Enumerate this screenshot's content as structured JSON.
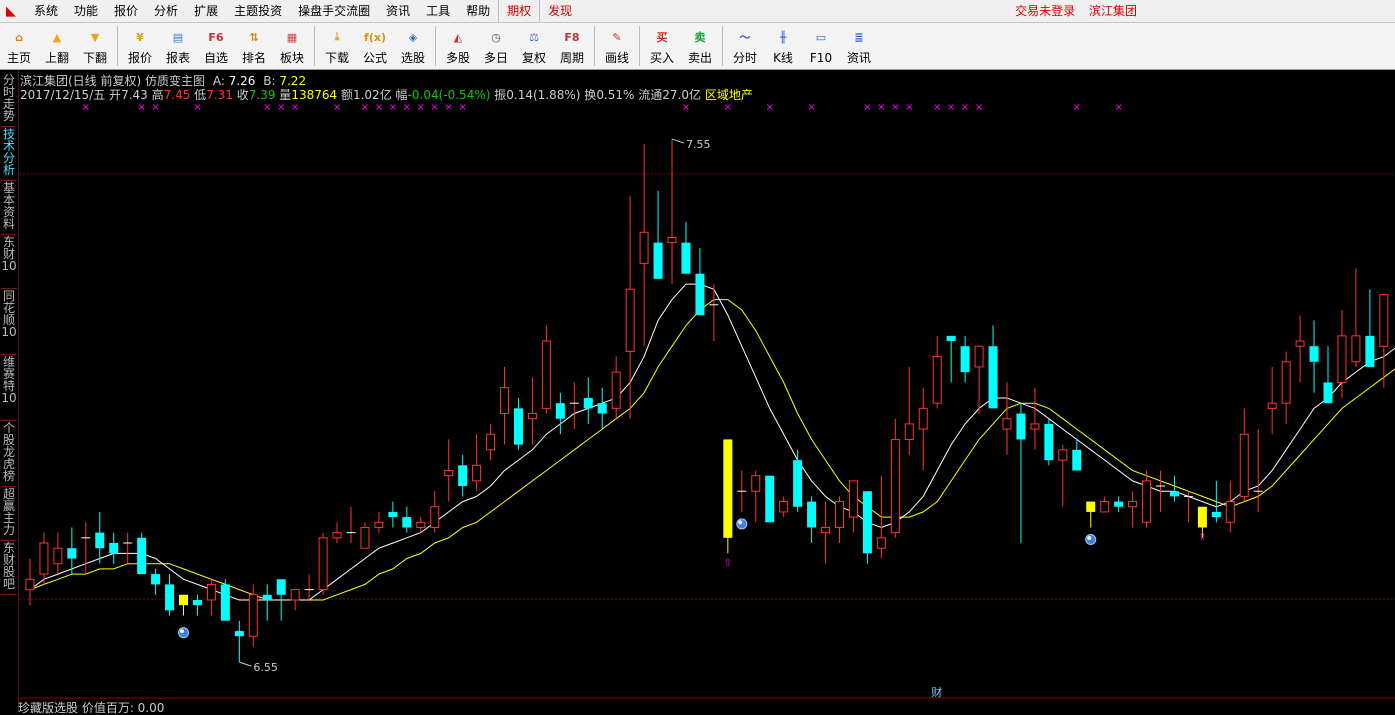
{
  "menubar": {
    "items": [
      "系统",
      "功能",
      "报价",
      "分析",
      "扩展",
      "主题投资",
      "操盘手交流圈",
      "资讯",
      "工具",
      "帮助"
    ],
    "red_items": [
      "期权",
      "发现"
    ],
    "status": "交易未登录",
    "stock": "滨江集团"
  },
  "toolbar": {
    "groups": [
      [
        {
          "label": "主页",
          "icon": "home-icon",
          "glyph": "⌂",
          "color": "#e57a1c"
        },
        {
          "label": "上翻",
          "icon": "arrow-up-icon",
          "glyph": "▲",
          "color": "#f0a020"
        },
        {
          "label": "下翻",
          "icon": "arrow-down-icon",
          "glyph": "▼",
          "color": "#f0a020"
        }
      ],
      [
        {
          "label": "报价",
          "icon": "yen-icon",
          "glyph": "¥",
          "color": "#e0a010"
        },
        {
          "label": "报表",
          "icon": "report-icon",
          "glyph": "▤",
          "color": "#3a7bd5"
        },
        {
          "label": "自选",
          "icon": "f6-icon",
          "glyph": "F6",
          "color": "#c03030"
        },
        {
          "label": "排名",
          "icon": "ranking-icon",
          "glyph": "⇅",
          "color": "#e08010"
        },
        {
          "label": "板块",
          "icon": "sector-icon",
          "glyph": "▦",
          "color": "#d04040"
        }
      ],
      [
        {
          "label": "下载",
          "icon": "download-icon",
          "glyph": "⤓",
          "color": "#e0a020"
        },
        {
          "label": "公式",
          "icon": "formula-icon",
          "glyph": "f(x)",
          "color": "#e09010"
        },
        {
          "label": "选股",
          "icon": "stock-pick-icon",
          "glyph": "◈",
          "color": "#3070c0"
        }
      ],
      [
        {
          "label": "多股",
          "icon": "multi-stock-icon",
          "glyph": "◭",
          "color": "#c03030"
        },
        {
          "label": "多日",
          "icon": "clock-icon",
          "glyph": "◷",
          "color": "#555555"
        },
        {
          "label": "复权",
          "icon": "restore-rights-icon",
          "glyph": "⚖",
          "color": "#3a6fd0"
        },
        {
          "label": "周期",
          "icon": "f8-icon",
          "glyph": "F8",
          "color": "#c03030"
        }
      ],
      [
        {
          "label": "画线",
          "icon": "draw-line-icon",
          "glyph": "✎",
          "color": "#c03030"
        }
      ],
      [
        {
          "label": "买入",
          "icon": "buy-icon",
          "glyph": "买",
          "color": "#d03020"
        },
        {
          "label": "卖出",
          "icon": "sell-icon",
          "glyph": "卖",
          "color": "#20a040"
        }
      ],
      [
        {
          "label": "分时",
          "icon": "intraday-icon",
          "glyph": "〜",
          "color": "#3060d0"
        },
        {
          "label": "K线",
          "icon": "kline-icon",
          "glyph": "╫",
          "color": "#3060d0"
        },
        {
          "label": "F10",
          "icon": "f10-icon",
          "glyph": "▭",
          "color": "#3060d0"
        },
        {
          "label": "资讯",
          "icon": "news-icon",
          "glyph": "≣",
          "color": "#3060d0"
        }
      ]
    ]
  },
  "side_tabs": [
    {
      "label": "分时走势",
      "active": false
    },
    {
      "label": "技术分析",
      "active": true
    },
    {
      "label": "基本资料",
      "active": false
    },
    {
      "label": "东财10",
      "active": false
    },
    {
      "label": "同花顺10",
      "active": false
    },
    {
      "label": "维赛特10",
      "active": false
    },
    {
      "label": "个股龙虎榜",
      "active": false
    },
    {
      "label": "超赢主力",
      "active": false
    },
    {
      "label": "东财股吧",
      "active": false
    }
  ],
  "chart_header": {
    "title": "滨江集团(日线 前复权) 仿质变主图",
    "a_label": "A:",
    "a_value": "7.26",
    "b_label": "B:",
    "b_value": "7.22"
  },
  "quote": {
    "date": "2017/12/15/五",
    "open_label": "开",
    "open": "7.43",
    "high_label": "高",
    "high": "7.45",
    "low_label": "低",
    "low": "7.31",
    "close_label": "收",
    "close": "7.39",
    "volume_label": "量",
    "volume": "138764",
    "amount_label": "额",
    "amount": "1.02亿",
    "change_label": "幅",
    "change": "-0.04(-0.54%)",
    "amplitude_label": "振",
    "amplitude": "0.14(1.88%)",
    "turnover_label": "换",
    "turnover": "0.51%",
    "float_label": "流通",
    "float": "27.0亿",
    "sector": "区域地产"
  },
  "annotations": {
    "high_mark": "7.55",
    "low_mark": "6.55",
    "finance_marker": "财"
  },
  "bottom_status": "珍藏版选股  价值百万: 0.00",
  "colors": {
    "up": "#ff3232",
    "down": "#00ffff",
    "special": "#ffff00",
    "ma_fast": "#ffffff",
    "ma_slow": "#ffff00",
    "marker": "#ff00ff",
    "grid": "#8b0000"
  },
  "chart_data": {
    "type": "candlestick",
    "y_range": [
      6.5,
      7.62
    ],
    "candles": [
      {
        "o": 6.69,
        "h": 6.75,
        "l": 6.66,
        "c": 6.71
      },
      {
        "o": 6.72,
        "h": 6.8,
        "l": 6.7,
        "c": 6.78
      },
      {
        "o": 6.74,
        "h": 6.8,
        "l": 6.72,
        "c": 6.77
      },
      {
        "o": 6.77,
        "h": 6.81,
        "l": 6.72,
        "c": 6.75
      },
      {
        "o": 6.79,
        "h": 6.82,
        "l": 6.72,
        "c": 6.79
      },
      {
        "o": 6.8,
        "h": 6.84,
        "l": 6.74,
        "c": 6.77
      },
      {
        "o": 6.78,
        "h": 6.8,
        "l": 6.74,
        "c": 6.76
      },
      {
        "o": 6.78,
        "h": 6.8,
        "l": 6.74,
        "c": 6.78
      },
      {
        "o": 6.79,
        "h": 6.8,
        "l": 6.72,
        "c": 6.72
      },
      {
        "o": 6.72,
        "h": 6.73,
        "l": 6.68,
        "c": 6.7
      },
      {
        "o": 6.7,
        "h": 6.72,
        "l": 6.64,
        "c": 6.65
      },
      {
        "o": 6.65,
        "h": 6.68,
        "l": 6.63,
        "c": 6.67
      },
      {
        "o": 6.67,
        "h": 6.68,
        "l": 6.64,
        "c": 6.66
      },
      {
        "o": 6.67,
        "h": 6.71,
        "l": 6.64,
        "c": 6.7
      },
      {
        "o": 6.7,
        "h": 6.71,
        "l": 6.63,
        "c": 6.63
      },
      {
        "o": 6.61,
        "h": 6.63,
        "l": 6.55,
        "c": 6.6
      },
      {
        "o": 6.6,
        "h": 6.7,
        "l": 6.58,
        "c": 6.68
      },
      {
        "o": 6.68,
        "h": 6.7,
        "l": 6.63,
        "c": 6.67
      },
      {
        "o": 6.71,
        "h": 6.71,
        "l": 6.63,
        "c": 6.68
      },
      {
        "o": 6.67,
        "h": 6.69,
        "l": 6.65,
        "c": 6.69
      },
      {
        "o": 6.69,
        "h": 6.72,
        "l": 6.67,
        "c": 6.69
      },
      {
        "o": 6.69,
        "h": 6.8,
        "l": 6.68,
        "c": 6.79
      },
      {
        "o": 6.79,
        "h": 6.82,
        "l": 6.78,
        "c": 6.8
      },
      {
        "o": 6.8,
        "h": 6.85,
        "l": 6.78,
        "c": 6.8
      },
      {
        "o": 6.77,
        "h": 6.82,
        "l": 6.77,
        "c": 6.81
      },
      {
        "o": 6.81,
        "h": 6.84,
        "l": 6.8,
        "c": 6.82
      },
      {
        "o": 6.84,
        "h": 6.86,
        "l": 6.81,
        "c": 6.83
      },
      {
        "o": 6.83,
        "h": 6.85,
        "l": 6.8,
        "c": 6.81
      },
      {
        "o": 6.81,
        "h": 6.83,
        "l": 6.8,
        "c": 6.82
      },
      {
        "o": 6.81,
        "h": 6.88,
        "l": 6.8,
        "c": 6.85
      },
      {
        "o": 6.91,
        "h": 6.98,
        "l": 6.86,
        "c": 6.92
      },
      {
        "o": 6.93,
        "h": 6.95,
        "l": 6.87,
        "c": 6.89
      },
      {
        "o": 6.9,
        "h": 6.99,
        "l": 6.88,
        "c": 6.93
      },
      {
        "o": 6.96,
        "h": 7.01,
        "l": 6.94,
        "c": 6.99
      },
      {
        "o": 7.03,
        "h": 7.12,
        "l": 6.97,
        "c": 7.08
      },
      {
        "o": 7.04,
        "h": 7.06,
        "l": 6.96,
        "c": 6.97
      },
      {
        "o": 7.02,
        "h": 7.1,
        "l": 6.97,
        "c": 7.03
      },
      {
        "o": 7.04,
        "h": 7.2,
        "l": 7.03,
        "c": 7.17
      },
      {
        "o": 7.05,
        "h": 7.07,
        "l": 6.99,
        "c": 7.02
      },
      {
        "o": 7.05,
        "h": 7.09,
        "l": 7.0,
        "c": 7.05
      },
      {
        "o": 7.06,
        "h": 7.1,
        "l": 7.01,
        "c": 7.04
      },
      {
        "o": 7.05,
        "h": 7.08,
        "l": 7.0,
        "c": 7.03
      },
      {
        "o": 7.04,
        "h": 7.14,
        "l": 7.02,
        "c": 7.11
      },
      {
        "o": 7.15,
        "h": 7.45,
        "l": 7.02,
        "c": 7.27
      },
      {
        "o": 7.32,
        "h": 7.55,
        "l": 7.16,
        "c": 7.38
      },
      {
        "o": 7.36,
        "h": 7.46,
        "l": 7.29,
        "c": 7.29
      },
      {
        "o": 7.36,
        "h": 7.56,
        "l": 7.28,
        "c": 7.37
      },
      {
        "o": 7.36,
        "h": 7.4,
        "l": 7.3,
        "c": 7.3
      },
      {
        "o": 7.3,
        "h": 7.35,
        "l": 7.22,
        "c": 7.22
      },
      {
        "o": 7.24,
        "h": 7.28,
        "l": 7.17,
        "c": 7.24
      },
      {
        "o": 6.98,
        "h": 6.98,
        "l": 6.76,
        "c": 6.88
      },
      {
        "o": 6.88,
        "h": 6.92,
        "l": 6.84,
        "c": 6.88
      },
      {
        "o": 6.88,
        "h": 6.92,
        "l": 6.82,
        "c": 6.91
      },
      {
        "o": 6.91,
        "h": 6.91,
        "l": 6.82,
        "c": 6.82
      },
      {
        "o": 6.84,
        "h": 6.87,
        "l": 6.83,
        "c": 6.86
      },
      {
        "o": 6.94,
        "h": 6.96,
        "l": 6.84,
        "c": 6.85
      },
      {
        "o": 6.86,
        "h": 6.87,
        "l": 6.78,
        "c": 6.81
      },
      {
        "o": 6.8,
        "h": 6.86,
        "l": 6.74,
        "c": 6.81
      },
      {
        "o": 6.81,
        "h": 6.87,
        "l": 6.78,
        "c": 6.86
      },
      {
        "o": 6.83,
        "h": 6.9,
        "l": 6.8,
        "c": 6.9
      },
      {
        "o": 6.88,
        "h": 6.88,
        "l": 6.74,
        "c": 6.76
      },
      {
        "o": 6.77,
        "h": 6.91,
        "l": 6.75,
        "c": 6.79
      },
      {
        "o": 6.8,
        "h": 7.02,
        "l": 6.79,
        "c": 6.98
      },
      {
        "o": 6.98,
        "h": 7.12,
        "l": 6.95,
        "c": 7.01
      },
      {
        "o": 7.0,
        "h": 7.08,
        "l": 6.92,
        "c": 7.04
      },
      {
        "o": 7.05,
        "h": 7.18,
        "l": 7.04,
        "c": 7.14
      },
      {
        "o": 7.18,
        "h": 7.17,
        "l": 7.09,
        "c": 7.17
      },
      {
        "o": 7.16,
        "h": 7.18,
        "l": 7.09,
        "c": 7.11
      },
      {
        "o": 7.12,
        "h": 7.16,
        "l": 7.03,
        "c": 7.16
      },
      {
        "o": 7.16,
        "h": 7.2,
        "l": 7.04,
        "c": 7.04
      },
      {
        "o": 7.0,
        "h": 7.09,
        "l": 6.95,
        "c": 7.02
      },
      {
        "o": 7.03,
        "h": 7.05,
        "l": 6.78,
        "c": 6.98
      },
      {
        "o": 7.0,
        "h": 7.08,
        "l": 6.96,
        "c": 7.01
      },
      {
        "o": 7.01,
        "h": 7.02,
        "l": 6.93,
        "c": 6.94
      },
      {
        "o": 6.94,
        "h": 6.97,
        "l": 6.85,
        "c": 6.96
      },
      {
        "o": 6.96,
        "h": 6.98,
        "l": 6.92,
        "c": 6.92
      },
      {
        "o": 6.86,
        "h": 6.9,
        "l": 6.81,
        "c": 6.84
      },
      {
        "o": 6.84,
        "h": 6.87,
        "l": 6.84,
        "c": 6.86
      },
      {
        "o": 6.86,
        "h": 6.87,
        "l": 6.84,
        "c": 6.85
      },
      {
        "o": 6.85,
        "h": 6.88,
        "l": 6.81,
        "c": 6.86
      },
      {
        "o": 6.82,
        "h": 6.92,
        "l": 6.81,
        "c": 6.9
      },
      {
        "o": 6.89,
        "h": 6.92,
        "l": 6.84,
        "c": 6.89
      },
      {
        "o": 6.88,
        "h": 6.91,
        "l": 6.86,
        "c": 6.87
      },
      {
        "o": 6.87,
        "h": 6.88,
        "l": 6.82,
        "c": 6.87
      },
      {
        "o": 6.86,
        "h": 6.86,
        "l": 6.81,
        "c": 6.84
      },
      {
        "o": 6.84,
        "h": 6.9,
        "l": 6.82,
        "c": 6.83
      },
      {
        "o": 6.82,
        "h": 6.9,
        "l": 6.8,
        "c": 6.86
      },
      {
        "o": 6.87,
        "h": 7.04,
        "l": 6.86,
        "c": 6.99
      },
      {
        "o": 6.88,
        "h": 7.0,
        "l": 6.84,
        "c": 6.88
      },
      {
        "o": 7.04,
        "h": 7.12,
        "l": 6.99,
        "c": 7.05
      },
      {
        "o": 7.05,
        "h": 7.15,
        "l": 7.01,
        "c": 7.13
      },
      {
        "o": 7.16,
        "h": 7.22,
        "l": 7.09,
        "c": 7.17
      },
      {
        "o": 7.16,
        "h": 7.21,
        "l": 7.07,
        "c": 7.13
      },
      {
        "o": 7.09,
        "h": 7.16,
        "l": 7.05,
        "c": 7.05
      },
      {
        "o": 7.09,
        "h": 7.23,
        "l": 7.06,
        "c": 7.18
      },
      {
        "o": 7.13,
        "h": 7.31,
        "l": 7.12,
        "c": 7.18
      },
      {
        "o": 7.18,
        "h": 7.27,
        "l": 7.12,
        "c": 7.12
      },
      {
        "o": 7.16,
        "h": 7.26,
        "l": 7.08,
        "c": 7.26
      }
    ],
    "special_bars": [
      {
        "i": 11,
        "o": 6.66,
        "c": 6.68,
        "l": 6.64
      },
      {
        "i": 50,
        "o": 6.98,
        "c": 6.79,
        "l": 6.76
      },
      {
        "i": 76,
        "o": 6.86,
        "c": 6.84,
        "l": 6.81
      },
      {
        "i": 84,
        "o": 6.85,
        "c": 6.81,
        "l": 6.79
      }
    ],
    "ball_markers": [
      11,
      51,
      76
    ],
    "arrow_markers": [
      50,
      84
    ],
    "top_marker_indices": [
      4,
      8,
      9,
      12,
      17,
      18,
      19,
      22,
      24,
      25,
      26,
      27,
      28,
      29,
      30,
      31,
      47,
      50,
      53,
      56,
      60,
      61,
      62,
      63,
      65,
      66,
      67,
      68,
      75,
      78
    ],
    "finance_marker_index": 65,
    "ma_fast": [
      6.69,
      6.71,
      6.72,
      6.73,
      6.74,
      6.75,
      6.76,
      6.76,
      6.76,
      6.75,
      6.73,
      6.71,
      6.7,
      6.69,
      6.68,
      6.67,
      6.67,
      6.67,
      6.67,
      6.67,
      6.67,
      6.69,
      6.71,
      6.73,
      6.75,
      6.77,
      6.78,
      6.79,
      6.8,
      6.82,
      6.84,
      6.86,
      6.87,
      6.89,
      6.92,
      6.94,
      6.96,
      6.99,
      7.01,
      7.03,
      7.04,
      7.05,
      7.06,
      7.09,
      7.14,
      7.21,
      7.25,
      7.28,
      7.28,
      7.27,
      7.22,
      7.16,
      7.1,
      7.04,
      6.99,
      6.94,
      6.9,
      6.87,
      6.85,
      6.84,
      6.82,
      6.81,
      6.82,
      6.84,
      6.87,
      6.92,
      6.97,
      7.01,
      7.04,
      7.06,
      7.06,
      7.05,
      7.04,
      7.02,
      7.0,
      6.98,
      6.96,
      6.94,
      6.92,
      6.9,
      6.89,
      6.88,
      6.88,
      6.87,
      6.86,
      6.85,
      6.86,
      6.88,
      6.89,
      6.92,
      6.96,
      7.0,
      7.04,
      7.06,
      7.09,
      7.11,
      7.13,
      7.14,
      7.16
    ],
    "ma_slow": [
      6.69,
      6.7,
      6.71,
      6.72,
      6.72,
      6.73,
      6.73,
      6.74,
      6.74,
      6.74,
      6.74,
      6.73,
      6.72,
      6.71,
      6.7,
      6.69,
      6.68,
      6.67,
      6.67,
      6.67,
      6.67,
      6.67,
      6.68,
      6.69,
      6.7,
      6.72,
      6.73,
      6.75,
      6.76,
      6.78,
      6.79,
      6.81,
      6.82,
      6.84,
      6.86,
      6.88,
      6.9,
      6.92,
      6.94,
      6.96,
      6.98,
      7.0,
      7.02,
      7.04,
      7.07,
      7.12,
      7.16,
      7.2,
      7.23,
      7.25,
      7.25,
      7.23,
      7.19,
      7.14,
      7.09,
      7.03,
      6.98,
      6.94,
      6.9,
      6.87,
      6.85,
      6.83,
      6.83,
      6.83,
      6.84,
      6.86,
      6.9,
      6.94,
      6.98,
      7.01,
      7.04,
      7.05,
      7.05,
      7.04,
      7.02,
      7.0,
      6.98,
      6.96,
      6.94,
      6.92,
      6.91,
      6.9,
      6.89,
      6.88,
      6.87,
      6.86,
      6.85,
      6.86,
      6.87,
      6.89,
      6.92,
      6.95,
      6.98,
      7.01,
      7.04,
      7.06,
      7.08,
      7.1,
      7.12
    ]
  }
}
